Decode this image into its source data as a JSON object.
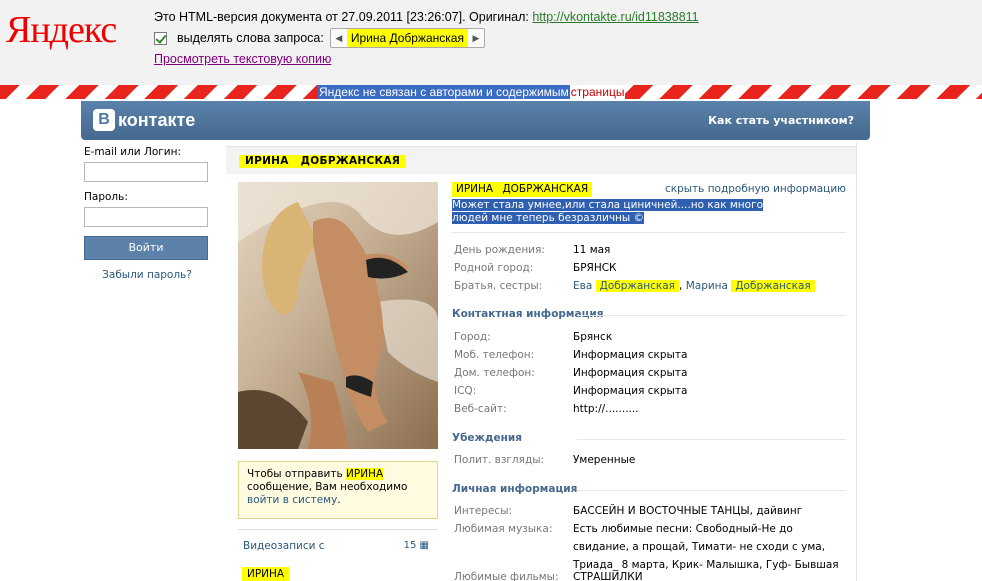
{
  "yandex": {
    "logo": "Яндекс",
    "line1_text": "Это HTML-версия документа от 27.09.2011 [23:26:07]. Оригинал: ",
    "original_url": "http://vkontakte.ru/id11838811",
    "highlight_label": "выделять слова запроса:",
    "query_word": "Ирина Добржанская",
    "text_copy_link": "Просмотреть текстовую копию",
    "disclaimer": "Яндекс не связан с авторами и содержимым",
    "disclaimer_tail": "страницы"
  },
  "vk": {
    "logo_letter": "В",
    "logo_text": "контакте",
    "join_link": "Как стать участником?",
    "login": {
      "email_label": "E-mail или Логин:",
      "password_label": "Пароль:",
      "login_button": "Войти",
      "forgot_link": "Забыли пароль?"
    },
    "profile": {
      "name_bar": "ИРИНА ДОБРЖАНСКАЯ",
      "header_name": "ИРИНА ДОБРЖАНСКАЯ",
      "hide_link": "скрыть подробную информацию",
      "status": "Может стала умнее,или стала циничней....но как много людей мне теперь безразличны ©",
      "message_box": {
        "pre": "Чтобы отправить ",
        "name": "ИРИНА",
        "mid": " сообщение, Вам необходимо ",
        "link": "войти в систему",
        "end": "."
      },
      "videos_label": "Видеозаписи с",
      "videos_count": "15",
      "videos_name": "ИРИНА",
      "basic": [
        {
          "k": "День рождения:",
          "v": "11 мая"
        },
        {
          "k": "Родной город:",
          "v": "БРЯНСК"
        }
      ],
      "siblings_label": "Братья, сестры:",
      "siblings": {
        "s1_first": "Ева",
        "s1_last": "Добржанская",
        "sep": ",",
        "s2_first": "Марина",
        "s2_last": "Добржанская"
      },
      "contact_title": "Контактная информация",
      "contact": [
        {
          "k": "Город:",
          "v": "Брянск"
        },
        {
          "k": "Моб. телефон:",
          "v": "Информация скрыта"
        },
        {
          "k": "Дом. телефон:",
          "v": "Информация скрыта"
        },
        {
          "k": "ICQ:",
          "v": "Информация скрыта"
        },
        {
          "k": "Веб-сайт:",
          "v": "http://.........."
        }
      ],
      "beliefs_title": "Убеждения",
      "beliefs": [
        {
          "k": "Полит. взгляды:",
          "v": "Умеренные"
        }
      ],
      "personal_title": "Личная информация",
      "interests_label": "Интересы:",
      "interests": "БАССЕЙН И ВОСТОЧНЫЕ ТАНЦЫ, дайвинг",
      "music_label": "Любимая музыка:",
      "music": "Есть любимые песни: Свободный-Не до свидание, а прощай, Тимати- не сходи с ума, Триада_ 8 марта, Крик- Малышка, Гуф- Бывшая",
      "films_label": "Любимые фильмы:",
      "films": "СТРАШИЛКИ"
    }
  }
}
